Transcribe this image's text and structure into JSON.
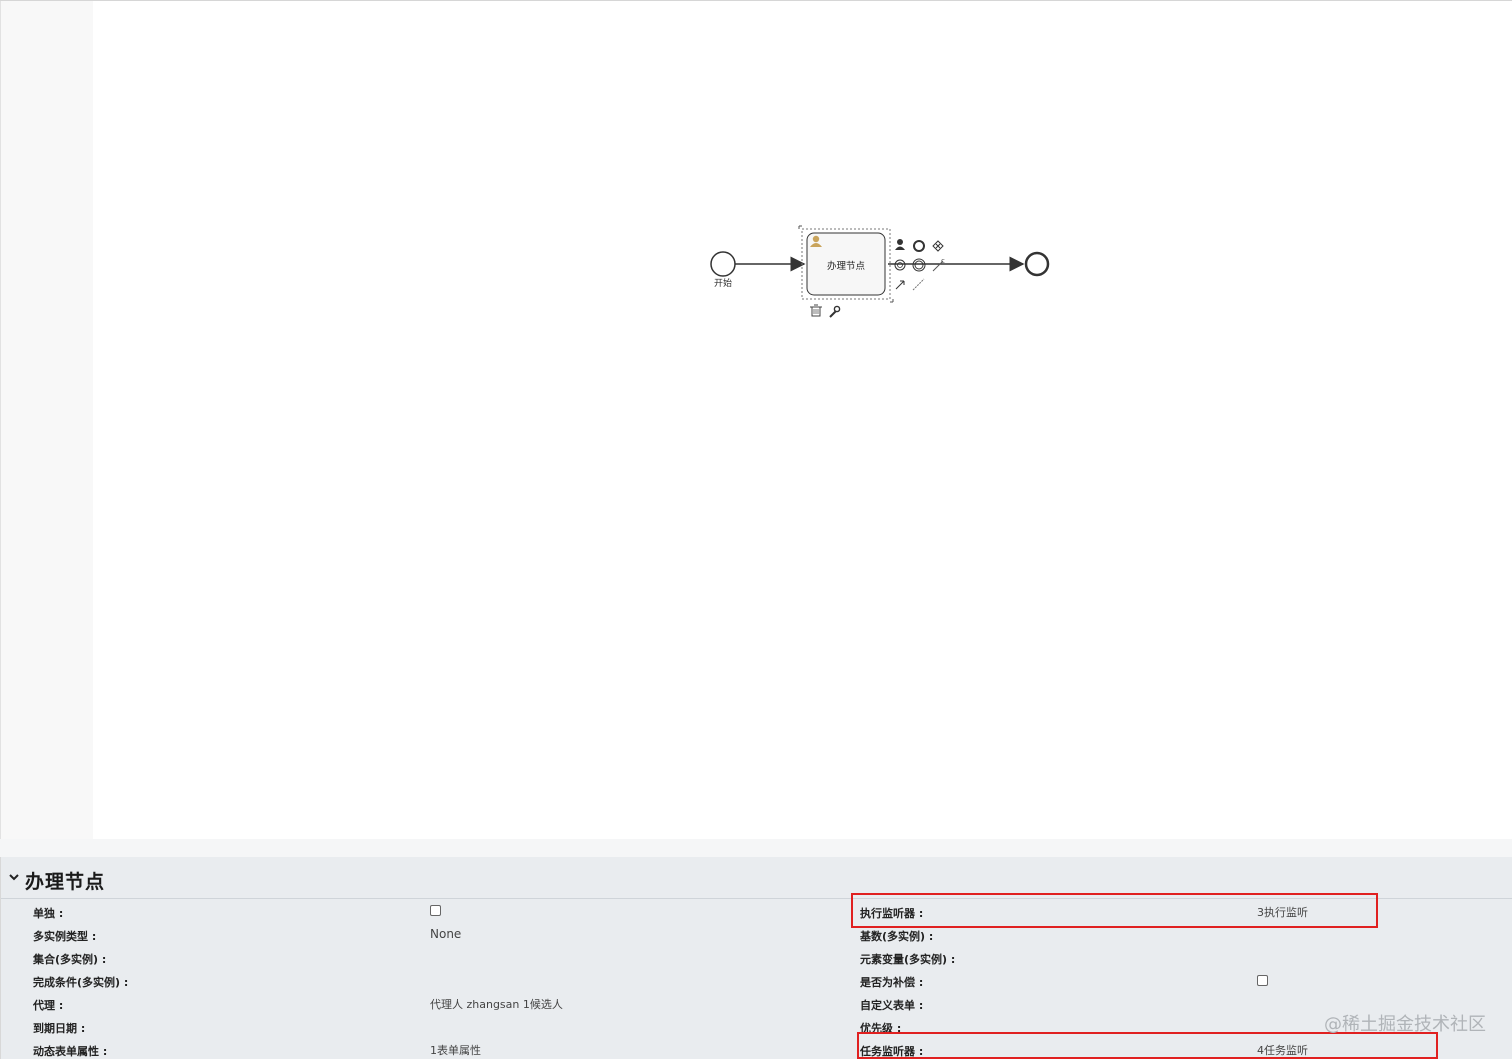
{
  "diagram": {
    "start_event_label": "开始",
    "task_label": "办理节点",
    "palette_icons": [
      "user-icon",
      "end-event-circle-icon",
      "gateway-icon",
      "boundary-timer-icon",
      "intermediate-event-icon",
      "connect-icon",
      "arrow-icon",
      "association-line-icon"
    ],
    "context_icons": [
      "trash-icon",
      "wrench-icon"
    ]
  },
  "panel": {
    "title": "办理节点",
    "left_props": [
      {
        "label": "单独 :",
        "type": "checkbox",
        "checked": false
      },
      {
        "label": "多实例类型 :",
        "value": "None"
      },
      {
        "label": "集合(多实例) :",
        "value": ""
      },
      {
        "label": "完成条件(多实例) :",
        "value": ""
      },
      {
        "label": "代理 :",
        "value": "代理人 zhangsan 1候选人"
      },
      {
        "label": "到期日期 :",
        "value": ""
      },
      {
        "label": "动态表单属性 :",
        "value": "1表单属性"
      }
    ],
    "right_props": [
      {
        "label": "执行监听器 :",
        "value": "3执行监听"
      },
      {
        "label": "基数(多实例) :",
        "value": ""
      },
      {
        "label": "元素变量(多实例) :",
        "value": ""
      },
      {
        "label": "是否为补偿 :",
        "type": "checkbox",
        "checked": false
      },
      {
        "label": "自定义表单 :",
        "value": ""
      },
      {
        "label": "优先级 :",
        "value": ""
      },
      {
        "label": "任务监听器 :",
        "value": "4任务监听"
      }
    ]
  },
  "highlight_color": "#e02020",
  "watermark": "@稀土掘金技术社区"
}
